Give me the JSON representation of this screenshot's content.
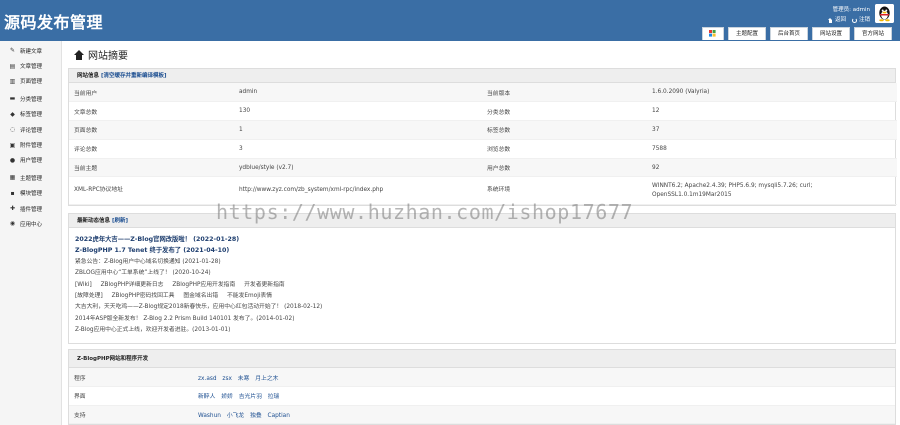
{
  "header": {
    "title": "源码发布管理",
    "admin_label": "管理员: admin",
    "return_label": "返回",
    "logout_label": "注销"
  },
  "top_tabs": [
    {
      "label": "主题配置"
    },
    {
      "label": "后台首页"
    },
    {
      "label": "网站设置"
    },
    {
      "label": "官方网站"
    }
  ],
  "sidebar": {
    "items": [
      {
        "label": "新建文章",
        "icon": "edit-icon"
      },
      {
        "label": "文章管理",
        "icon": "document-icon"
      },
      {
        "label": "页面管理",
        "icon": "page-icon"
      },
      {
        "label": "分类管理",
        "icon": "folder-icon"
      },
      {
        "label": "标签管理",
        "icon": "tag-icon"
      },
      {
        "label": "评论管理",
        "icon": "comment-icon"
      },
      {
        "label": "附件管理",
        "icon": "attachment-icon"
      },
      {
        "label": "用户管理",
        "icon": "user-icon"
      },
      {
        "label": "主题管理",
        "icon": "theme-icon"
      },
      {
        "label": "模块管理",
        "icon": "module-icon"
      },
      {
        "label": "插件管理",
        "icon": "plugin-icon"
      },
      {
        "label": "应用中心",
        "icon": "app-center-icon"
      }
    ]
  },
  "page": {
    "title": "网站摘要"
  },
  "site_info": {
    "heading": "网站信息",
    "heading_link": "[清空缓存并重新编译模板]",
    "rows": [
      [
        "当前用户",
        "admin",
        "当前版本",
        "1.6.0.2090 (Valyria)"
      ],
      [
        "文章总数",
        "130",
        "分类总数",
        "12"
      ],
      [
        "页面总数",
        "1",
        "标签总数",
        "37"
      ],
      [
        "评论总数",
        "3",
        "浏览总数",
        "7588"
      ],
      [
        "当前主题",
        "ydblue/style (v2.7)",
        "用户总数",
        "92"
      ],
      [
        "XML-RPC协议地址",
        "http://www.zyz.com/zb_system/xml-rpc/index.php",
        "系统环境",
        "WINNT6.2; Apache2.4.39; PHP5.6.9; mysqli5.7.26; curl; OpenSSL1.0.1m19Mar2015"
      ]
    ]
  },
  "news": {
    "heading": "最新动态信息",
    "heading_link": "[刷新]",
    "lines": [
      {
        "bold": true,
        "items": [
          "2022虎年大吉——Z-Blog官网改版啦！ (2022-01-28)"
        ]
      },
      {
        "bold": true,
        "items": [
          "Z-BlogPHP 1.7 Tenet 终于发布了 (2021-04-10)"
        ]
      },
      {
        "bold": false,
        "items": [
          "紧急公告：Z-Blog用户中心域名切换通知 (2021-01-28)"
        ]
      },
      {
        "bold": false,
        "items": [
          "ZBLOG应用中心“工单系统”上线了！ (2020-10-24)"
        ]
      },
      {
        "bold": false,
        "items": [
          "[Wiki]",
          "ZBlogPHP详细更新日志",
          "ZBlogPHP应用开发指南",
          "开发者更新指南"
        ]
      },
      {
        "bold": false,
        "items": [
          "[故障处理]",
          "ZBlogPHP密码找回工具",
          "图金域名出错",
          "不能发Emoji表情"
        ]
      },
      {
        "bold": false,
        "items": [
          "大吉大利，天天吃鸡——Z-Blog规定2018新春快乐，应用中心红包活动开始了！ (2018-02-12)"
        ]
      },
      {
        "bold": false,
        "items": [
          "2014年ASP版全新发布！ Z-Blog 2.2 Prism Build 140101 发布了。(2014-01-02)"
        ]
      },
      {
        "bold": false,
        "items": [
          "Z-Blog应用中心正式上线，欢迎开发者进驻。(2013-01-01)"
        ]
      }
    ]
  },
  "dev": {
    "heading": "Z-BlogPHP网站和程序开发",
    "rows": [
      {
        "label": "程序",
        "names": [
          "zx.asd",
          "zsx",
          "未寒",
          "月上之木"
        ]
      },
      {
        "label": "界面",
        "names": [
          "新醉人",
          "娇娇",
          "吉光片羽",
          "拉瑞"
        ]
      },
      {
        "label": "支持",
        "names": [
          "Washun",
          "小飞龙",
          "独叠",
          "Captian"
        ]
      }
    ]
  },
  "watermark": "https://www.huzhan.com/ishop17677",
  "colors": {
    "header_bg": "#3a6ea5",
    "link": "#1d4f91",
    "news_bold": "#1d3d6e"
  }
}
